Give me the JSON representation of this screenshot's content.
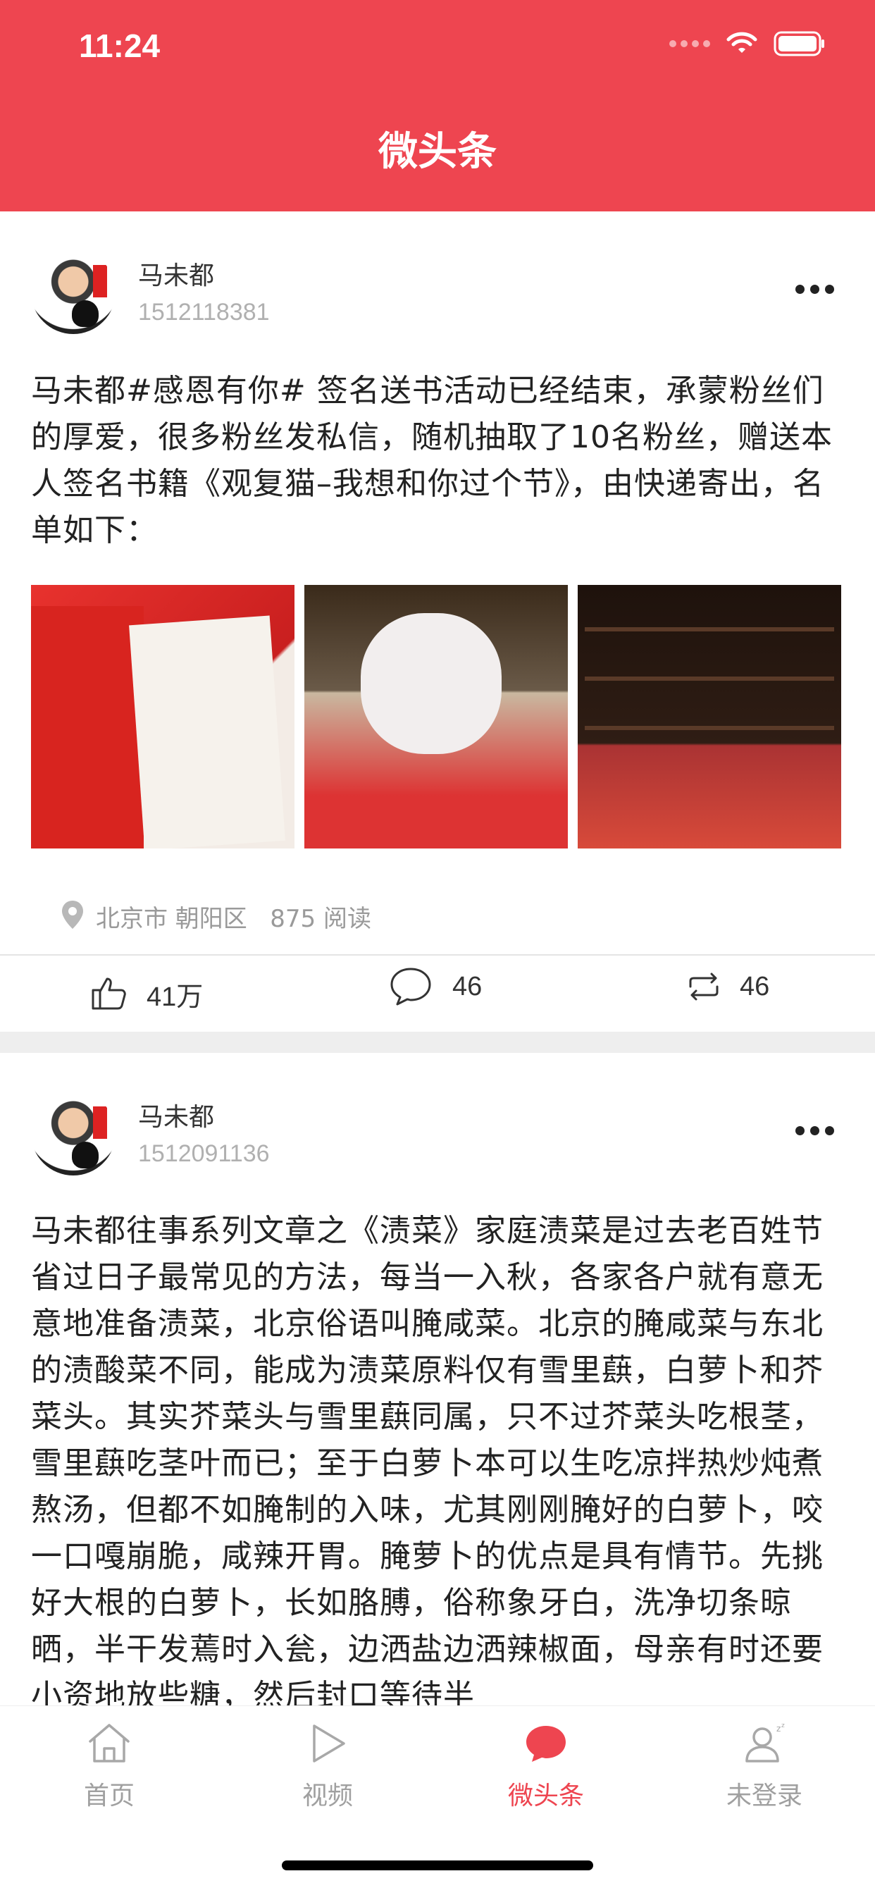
{
  "status_bar": {
    "time": "11:24"
  },
  "nav": {
    "title": "微头条"
  },
  "posts": [
    {
      "author": "马未都",
      "id": "1512118381",
      "text": "马未都#感恩有你# 签名送书活动已经结束，承蒙粉丝们的厚爱，很多粉丝发私信，随机抽取了10名粉丝，赠送本人签名书籍《观复猫–我想和你过个节》，由快递寄出，名单如下：",
      "images": [
        "signed-book-photo",
        "cat-cutout-and-books-photo",
        "shop-shelves-and-books-photo"
      ],
      "location": "北京市 朝阳区",
      "reads": "875 阅读",
      "likes": "41万",
      "comments": "46",
      "reposts": "46"
    },
    {
      "author": "马未都",
      "id": "1512091136",
      "text": "马未都往事系列文章之《渍菜》家庭渍菜是过去老百姓节省过日子最常见的方法，每当一入秋，各家各户就有意无意地准备渍菜，北京俗语叫腌咸菜。北京的腌咸菜与东北的渍酸菜不同，能成为渍菜原料仅有雪里蕻，白萝卜和芥菜头。其实芥菜头与雪里蕻同属，只不过芥菜头吃根茎，雪里蕻吃茎叶而已；至于白萝卜本可以生吃凉拌热炒炖煮熬汤，但都不如腌制的入味，尤其刚刚腌好的白萝卜，咬一口嘎崩脆，咸辣开胃。腌萝卜的优点是具有情节。先挑好大根的白萝卜，长如胳膊，俗称象牙白，洗净切条晾晒，半干发蔫时入瓮，边洒盐边洒辣椒面，母亲有时还要小资地放些糖，然后封口等待半"
    }
  ],
  "tabs": [
    {
      "label": "首页",
      "icon": "home-icon"
    },
    {
      "label": "视频",
      "icon": "play-icon"
    },
    {
      "label": "微头条",
      "icon": "chat-bubble-icon",
      "active": true
    },
    {
      "label": "未登录",
      "icon": "user-icon"
    }
  ],
  "colors": {
    "brand": "#ee4550",
    "muted": "#a0a0a0"
  }
}
